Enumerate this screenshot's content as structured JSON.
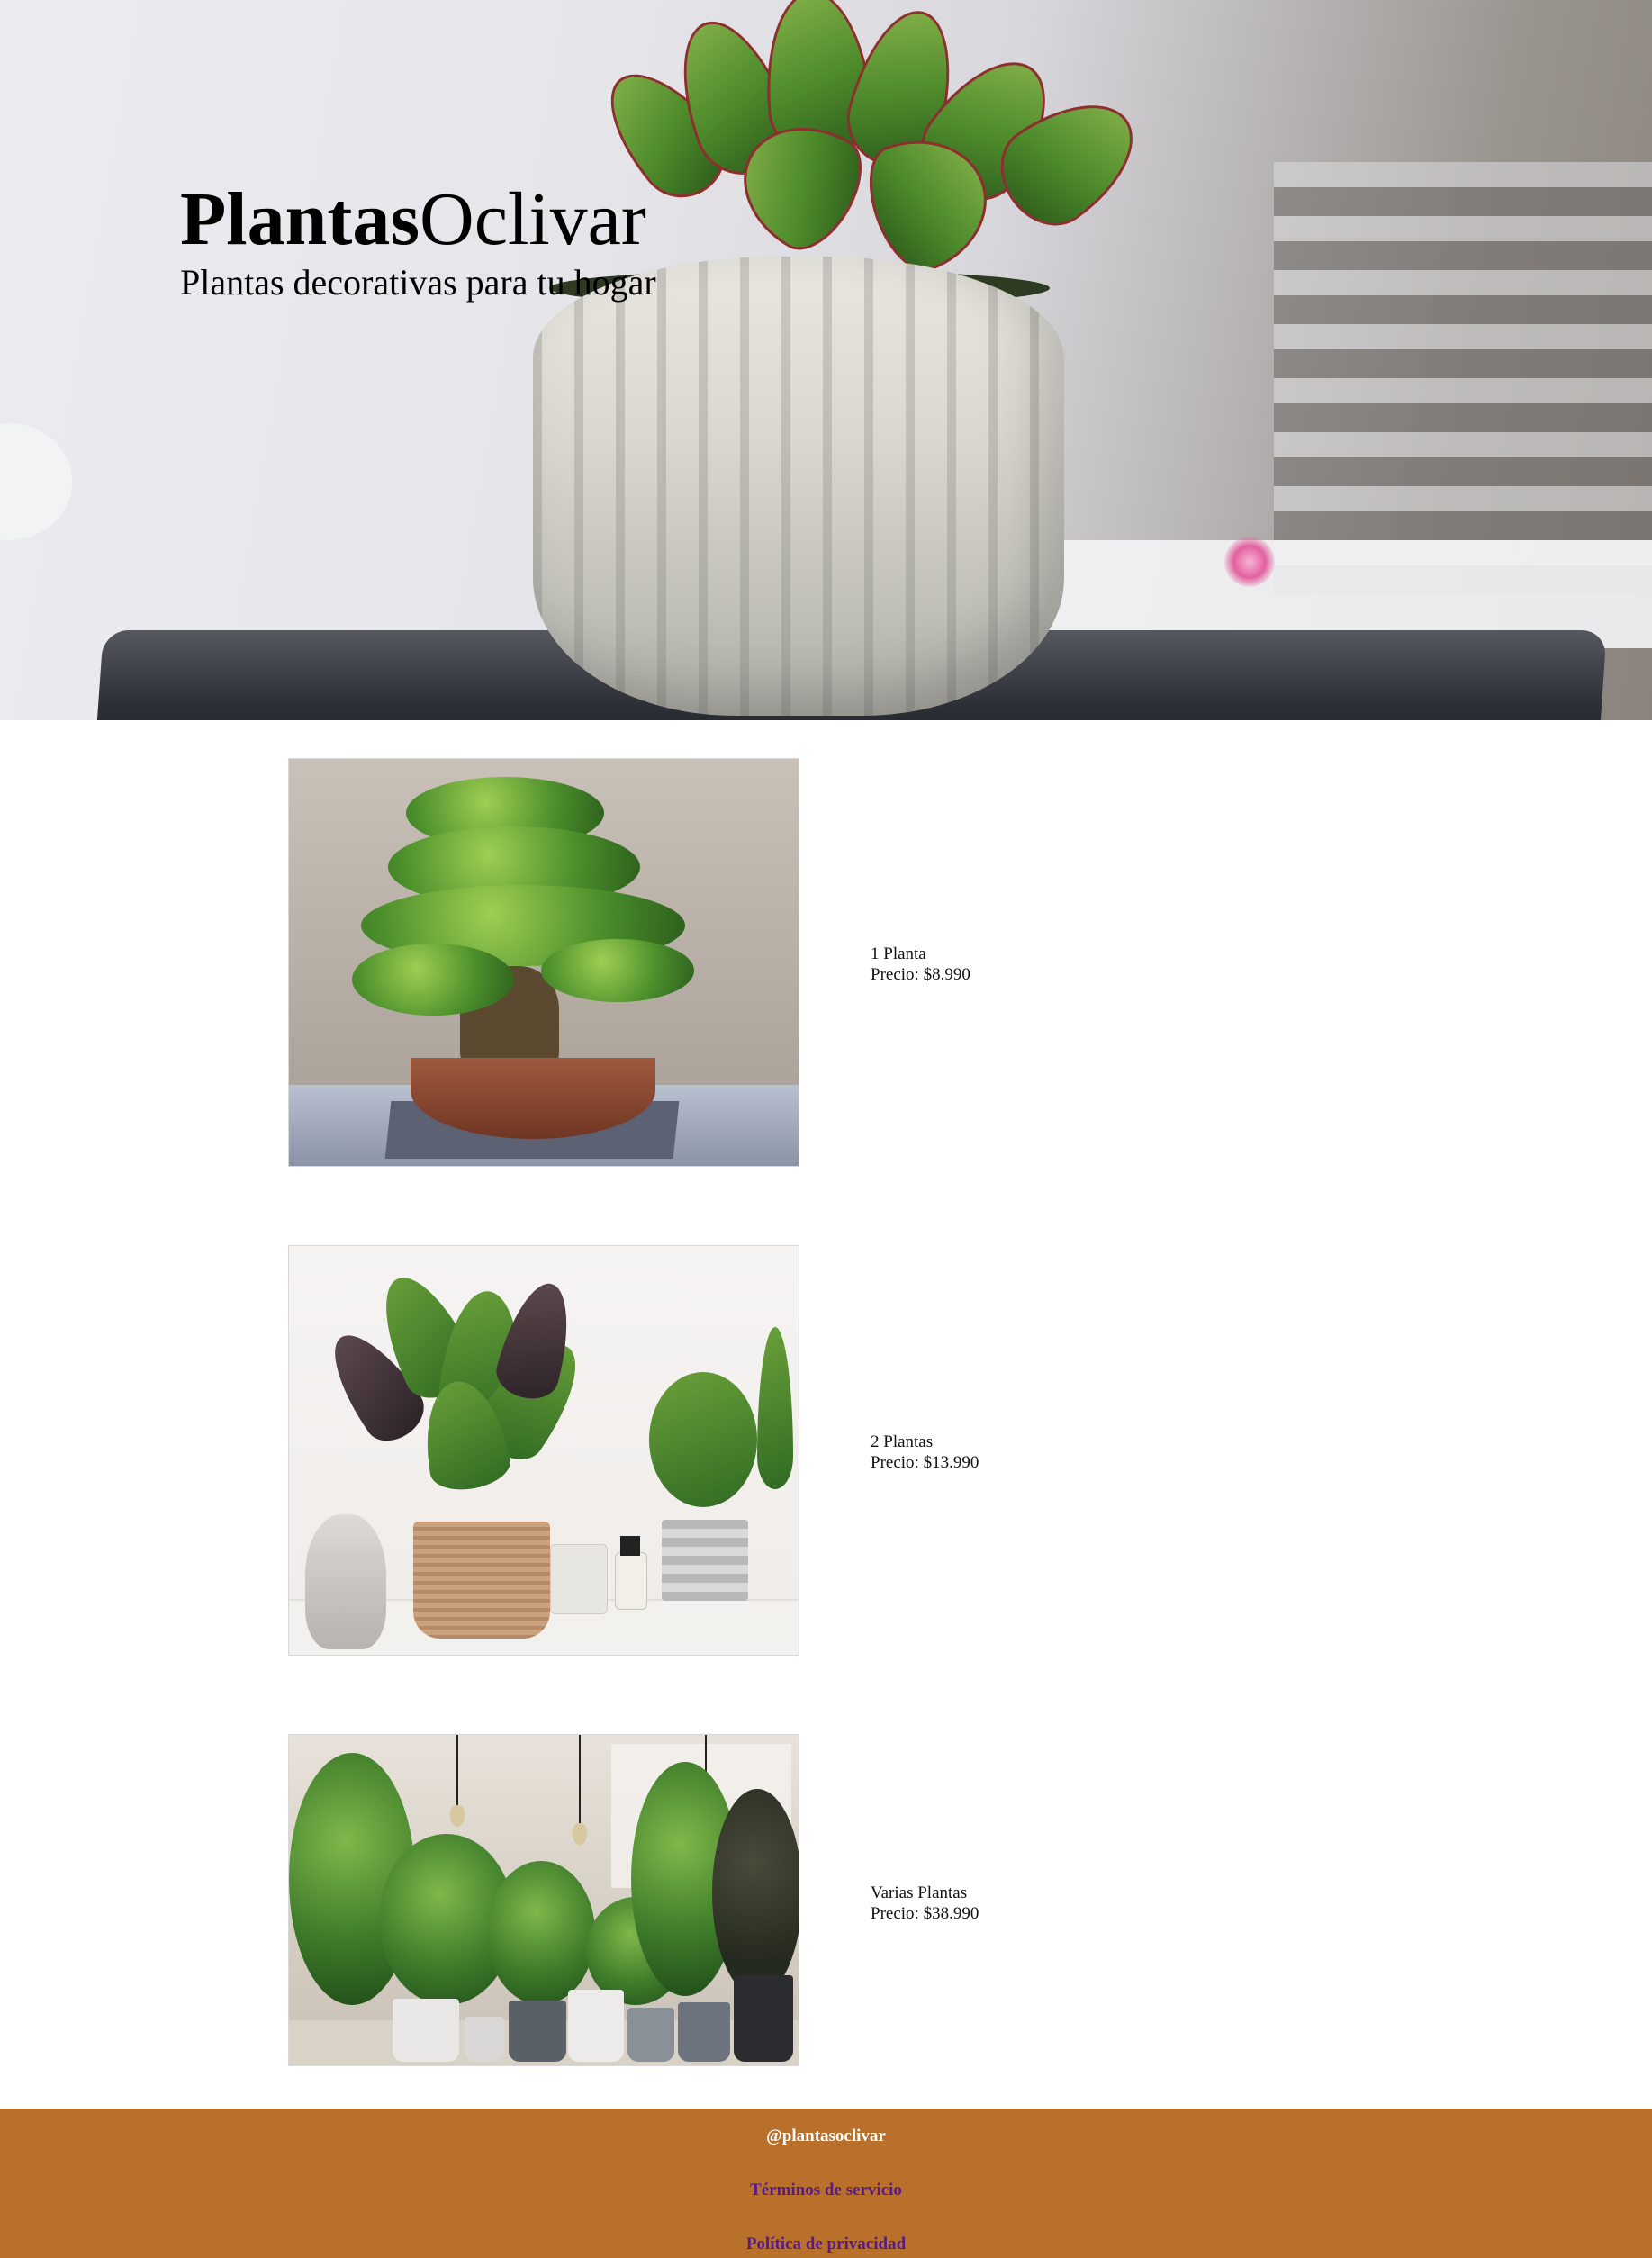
{
  "hero": {
    "brand_bold": "Plantas",
    "brand_light": "Oclivar",
    "tagline": "Plantas decorativas para tu hogar"
  },
  "products": [
    {
      "name": "1 Planta",
      "price": "Precio: $8.990",
      "image": "bonsai-photo"
    },
    {
      "name": "2 Plantas",
      "price": "Precio: $13.990",
      "image": "calathea-shelf-photo"
    },
    {
      "name": "Varias Plantas",
      "price": "Precio: $38.990",
      "image": "indoor-plants-photo"
    }
  ],
  "footer": {
    "handle": "@plantasoclivar",
    "terms": "Términos de servicio",
    "privacy": "Política de privacidad"
  },
  "colors": {
    "footer_bg": "#b8702b",
    "footer_handle": "#ffffff",
    "footer_link": "#551a8b"
  }
}
